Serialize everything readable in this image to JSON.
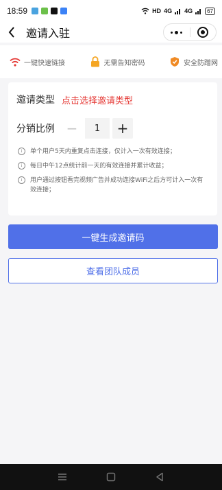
{
  "status_bar": {
    "time": "18:59",
    "network": "HD",
    "signal_1": "4G",
    "signal_2": "4G",
    "battery": "67",
    "icons": [
      "app-icon",
      "app-icon",
      "tiktok-icon",
      "app-icon",
      "wifi-icon",
      "signal-icon",
      "battery-icon"
    ]
  },
  "nav": {
    "title": "邀请入驻",
    "icons": [
      "back-arrow-icon",
      "more-dots-icon",
      "close-target-icon"
    ]
  },
  "features": [
    {
      "label": "一键快速链接",
      "icon": "wifi-icon",
      "color": "#e53935"
    },
    {
      "label": "无需告知密码",
      "icon": "lock-icon",
      "color": "#f5a623"
    },
    {
      "label": "安全防蹭网",
      "icon": "shield-icon",
      "color": "#f08a24"
    }
  ],
  "form": {
    "type_label": "邀请类型",
    "type_select": "点击选择邀请类型",
    "ratio_label": "分销比例",
    "ratio_value": "1",
    "minus_symbol": "−",
    "plus_symbol": "+"
  },
  "notes": [
    "单个用户5天内重复点击连接，仅计入一次有效连接；",
    "每日中午12点统计前一天的有效连接并累计收益；",
    "用户通过按钮看完视频广告并成功连接WiFi之后方可计入一次有效连接；"
  ],
  "note_icon_symbol": "i",
  "buttons": {
    "generate": "一键生成邀请码",
    "view_team": "查看团队成员"
  },
  "colors": {
    "accent": "#5070e8",
    "select_red": "#e53935",
    "background": "#f5f5f7"
  }
}
